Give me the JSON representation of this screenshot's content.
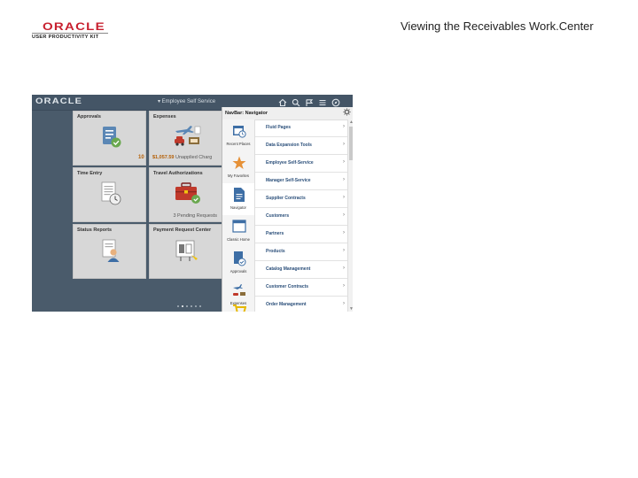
{
  "slide": {
    "title": "Viewing the Receivables Work.Center",
    "logo_word": "ORACLE",
    "logo_sub": "USER PRODUCTIVITY KIT"
  },
  "app": {
    "logo": "ORACLE",
    "title": "▾ Employee Self Service",
    "topbar_icons": [
      "home-icon",
      "search-icon",
      "flag-icon",
      "menu-icon",
      "compass-icon"
    ]
  },
  "tiles": [
    {
      "title": "Approvals",
      "number": "10",
      "icon": "document-check-icon"
    },
    {
      "title": "Expenses",
      "amount": "$1,057.59",
      "amount_note": "Unapplied Charg",
      "icon": "travel-icon"
    },
    {
      "title": "Time Entry",
      "icon": "timesheet-icon"
    },
    {
      "title": "Travel Authorizations",
      "footer": "3 Pending Requests",
      "icon": "briefcase-icon"
    },
    {
      "title": "Status Reports",
      "icon": "person-report-icon"
    },
    {
      "title": "Payment Request Center",
      "icon": "payment-icon"
    }
  ],
  "page_dots": {
    "count": 6,
    "active": 1
  },
  "navbar": {
    "title": "NavBar: Navigator",
    "rail": [
      {
        "label": "Recent Places",
        "icon": "calendar-clock-icon"
      },
      {
        "label": "My Favorites",
        "icon": "star-icon"
      },
      {
        "label": "Navigator",
        "icon": "document-icon",
        "selected": true
      },
      {
        "label": "Classic Home",
        "icon": "window-icon"
      },
      {
        "label": "Approvals",
        "icon": "approvals-icon"
      },
      {
        "label": "Expenses",
        "icon": "expenses-icon"
      },
      {
        "label": "",
        "icon": "cart-icon"
      }
    ],
    "items": [
      "Fluid Pages",
      "Data Expansion Tools",
      "Employee Self-Service",
      "Manager Self-Service",
      "Supplier Contracts",
      "Customers",
      "Partners",
      "Products",
      "Catalog Management",
      "Customer Contracts",
      "Order Management"
    ],
    "chevron": "›"
  },
  "colors": {
    "oracle_red": "#c8202f",
    "app_background": "#4a5b6b",
    "tile_background": "#d7d7d7",
    "link_blue": "#2b4f7a",
    "accent_orange": "#b45f06"
  }
}
